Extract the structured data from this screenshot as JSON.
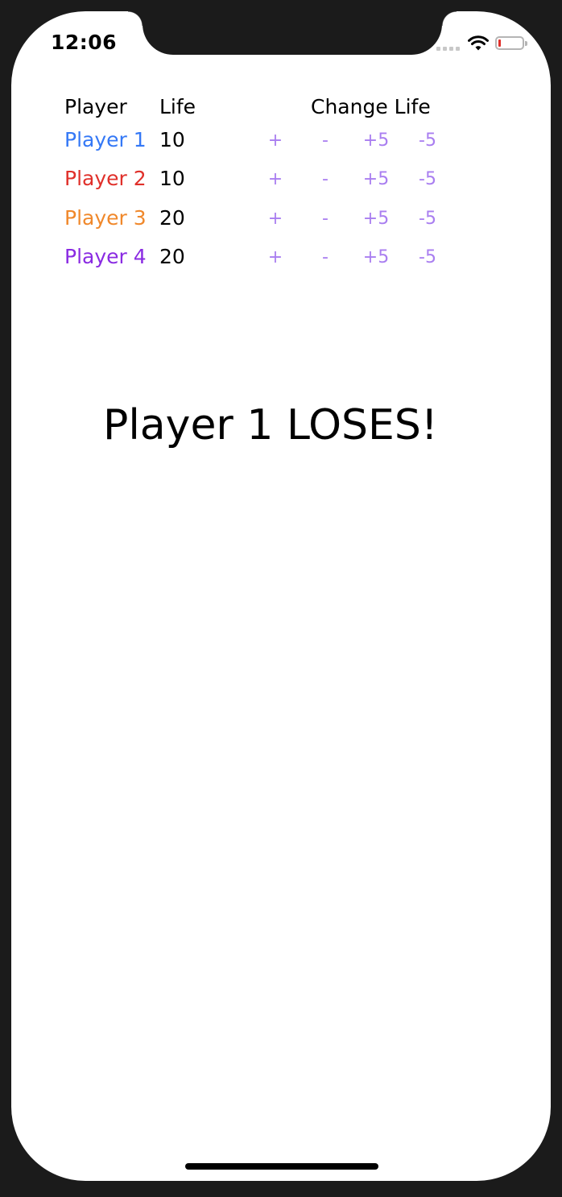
{
  "status_bar": {
    "time": "12:06",
    "battery_level": 0.08
  },
  "table": {
    "headers": {
      "player": "Player",
      "life": "Life",
      "change_life": "Change Life"
    },
    "buttons": {
      "plus_one": "+",
      "minus_one": "-",
      "plus_five": "+5",
      "minus_five": "-5"
    },
    "rows": [
      {
        "name": "Player 1",
        "life": "10",
        "color": "#3478f6"
      },
      {
        "name": "Player 2",
        "life": "10",
        "color": "#e0302a"
      },
      {
        "name": "Player 3",
        "life": "20",
        "color": "#f0882b"
      },
      {
        "name": "Player 4",
        "life": "20",
        "color": "#8a2be2"
      }
    ]
  },
  "message": "Player 1 LOSES!",
  "colors": {
    "button": "#a97ef0",
    "frame": "#1b1b1b"
  }
}
